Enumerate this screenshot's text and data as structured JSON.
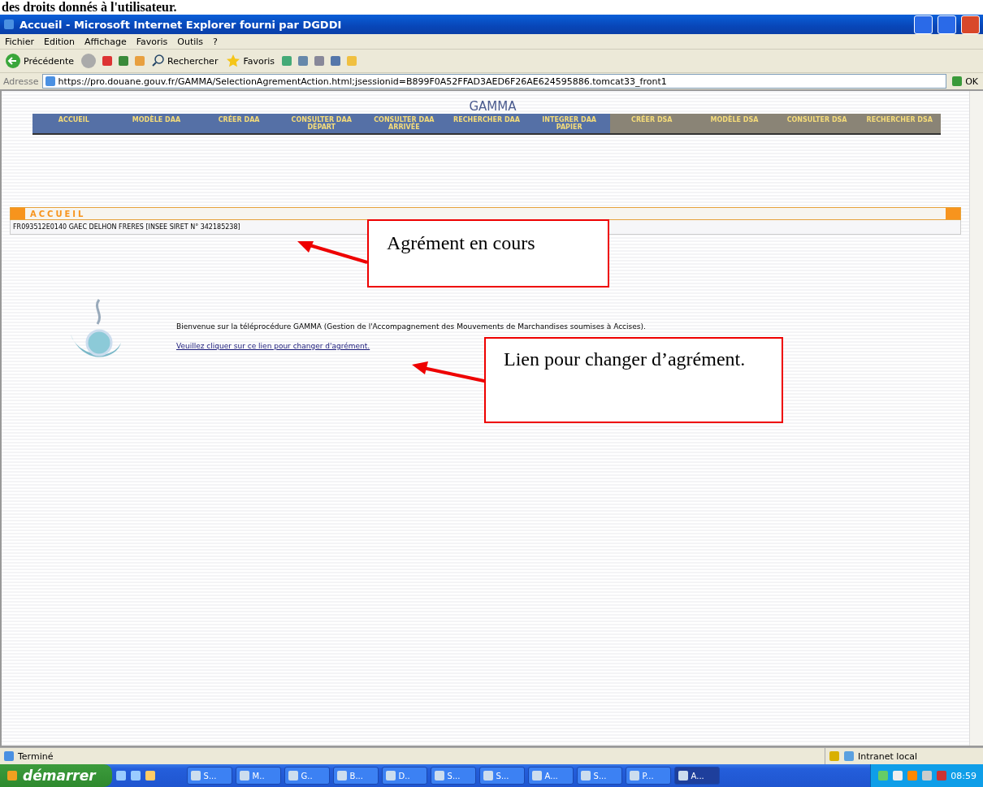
{
  "document_text": "des droits donnés à l'utilisateur.",
  "window": {
    "title": "Accueil - Microsoft Internet Explorer fourni par DGDDI"
  },
  "menu": [
    "Fichier",
    "Edition",
    "Affichage",
    "Favoris",
    "Outils",
    "?"
  ],
  "toolbar": {
    "back": "Précédente",
    "search": "Rechercher",
    "favorites": "Favoris"
  },
  "address": {
    "label": "Adresse",
    "value": "https://pro.douane.gouv.fr/GAMMA/SelectionAgrementAction.html;jsessionid=B899F0A52FFAD3AED6F26AE624595886.tomcat33_front1",
    "go": "OK"
  },
  "page": {
    "site_title": "GAMMA",
    "nav": [
      {
        "label": "ACCUEIL",
        "kind": "daa"
      },
      {
        "label": "MODÈLE DAA",
        "kind": "daa"
      },
      {
        "label": "CRÉER DAA",
        "kind": "daa"
      },
      {
        "label": "CONSULTER DAA DÉPART",
        "kind": "daa"
      },
      {
        "label": "CONSULTER DAA ARRIVÉE",
        "kind": "daa"
      },
      {
        "label": "RECHERCHER DAA",
        "kind": "daa"
      },
      {
        "label": "INTEGRER DAA PAPIER",
        "kind": "daa"
      },
      {
        "label": "CRÉER DSA",
        "kind": "dsa"
      },
      {
        "label": "MODÈLE DSA",
        "kind": "dsa"
      },
      {
        "label": "CONSULTER DSA",
        "kind": "dsa"
      },
      {
        "label": "RECHERCHER DSA",
        "kind": "dsa"
      }
    ],
    "section_title": "ACCUEIL",
    "agreement": "FR093512E0140 GAEC DELHON FRERES [INSEE SIRET N° 342185238]",
    "welcome": "Bienvenue sur la téléprocédure GAMMA (Gestion de l'Accompagnement des Mouvements de Marchandises soumises à Accises).",
    "link": "Veuillez cliquer sur ce lien pour changer d'agrément."
  },
  "callouts": [
    "Agrément en cours",
    "Lien pour changer d’agrément."
  ],
  "status_bar": {
    "status": "Terminé",
    "zone": "Intranet local"
  },
  "taskbar": {
    "start": "démarrer",
    "tasks": [
      {
        "label": "S...",
        "selected": false
      },
      {
        "label": "M..",
        "selected": false
      },
      {
        "label": "G..",
        "selected": false
      },
      {
        "label": "B...",
        "selected": false
      },
      {
        "label": "D..",
        "selected": false
      },
      {
        "label": "S...",
        "selected": false
      },
      {
        "label": "S...",
        "selected": false
      },
      {
        "label": "A...",
        "selected": false
      },
      {
        "label": "S...",
        "selected": false
      },
      {
        "label": "P...",
        "selected": false
      },
      {
        "label": "A...",
        "selected": true
      }
    ],
    "clock": "08:59"
  }
}
